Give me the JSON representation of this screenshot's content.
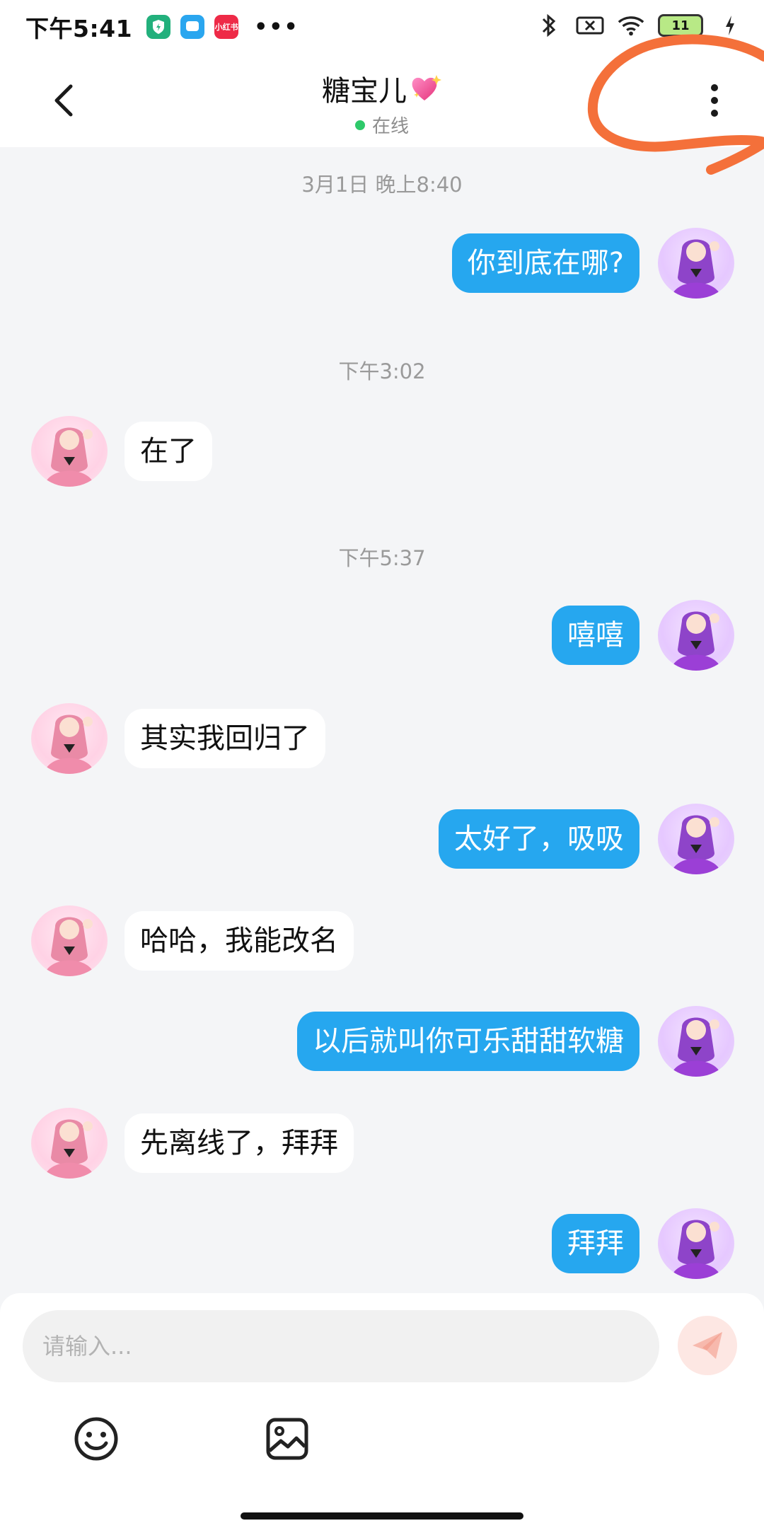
{
  "status_bar": {
    "time": "下午5:41",
    "apps": [
      "shield-app",
      "chat-app",
      "小红书"
    ],
    "more": "•••",
    "battery": "11"
  },
  "header": {
    "title": "糖宝儿",
    "status": "在线"
  },
  "messages": [
    {
      "type": "timestamp",
      "text": "3月1日 晚上8:40"
    },
    {
      "type": "self",
      "text": "你到底在哪?"
    },
    {
      "type": "timestamp",
      "text": "下午3:02"
    },
    {
      "type": "peer",
      "text": "在了"
    },
    {
      "type": "timestamp",
      "text": "下午5:37"
    },
    {
      "type": "self",
      "text": "嘻嘻"
    },
    {
      "type": "peer",
      "text": "其实我回归了"
    },
    {
      "type": "self",
      "text": "太好了，吸吸"
    },
    {
      "type": "peer",
      "text": "哈哈，我能改名"
    },
    {
      "type": "self",
      "text": "以后就叫你可乐甜甜软糖"
    },
    {
      "type": "peer",
      "text": "先离线了，拜拜"
    },
    {
      "type": "self",
      "text": "拜拜"
    }
  ],
  "input": {
    "placeholder": "请输入..."
  },
  "colors": {
    "self_bubble": "#26a7ef",
    "peer_bubble": "#ffffff",
    "online": "#2ec96a",
    "annotation": "#f4703a"
  }
}
